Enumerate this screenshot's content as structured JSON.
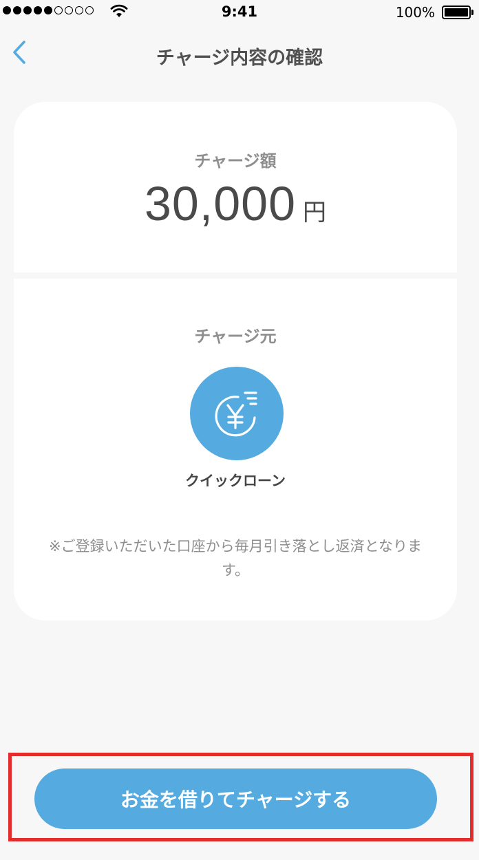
{
  "status_bar": {
    "time": "9:41",
    "battery_pct": "100%",
    "signal_bars_filled": 5,
    "signal_bars_total": 9
  },
  "nav": {
    "title": "チャージ内容の確認",
    "back_icon": "chevron-left-icon"
  },
  "amount": {
    "label": "チャージ額",
    "value": "30,000",
    "unit": "円"
  },
  "source": {
    "label": "チャージ元",
    "icon": "yen-coin-icon",
    "name": "クイックローン",
    "note": "※ご登録いただいた口座から毎月引き落とし返済となります。"
  },
  "action": {
    "button_label": "お金を借りてチャージする"
  },
  "colors": {
    "accent": "#55abe0",
    "highlight": "#e32c2c",
    "background": "#f7f7f7",
    "card": "#ffffff"
  }
}
